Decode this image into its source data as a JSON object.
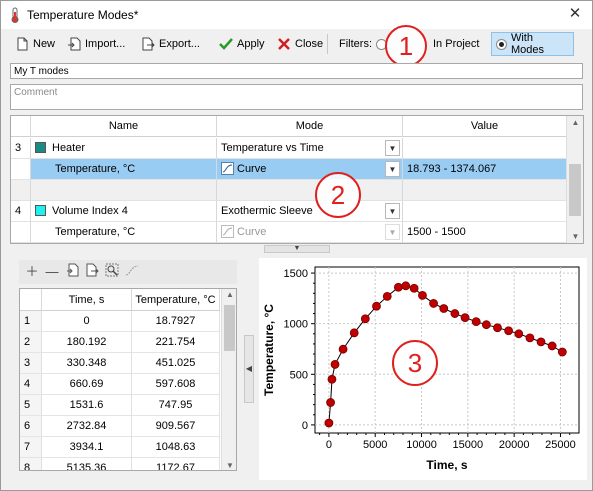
{
  "window": {
    "title": "Temperature Modes*",
    "close_symbol": "✕"
  },
  "toolbar": {
    "new": "New",
    "import": "Import...",
    "export": "Export...",
    "apply": "Apply",
    "close": "Close",
    "filters": "Filters:",
    "in_project": "In Project",
    "with_modes": "With Modes",
    "with_modes_selected": true
  },
  "name_field": {
    "value": "My T modes"
  },
  "comment_field": {
    "placeholder": "Comment"
  },
  "grid": {
    "columns": [
      "Name",
      "Mode",
      "Value"
    ],
    "rows": [
      {
        "index": "3",
        "name": "Heater",
        "color": "#1a8a84",
        "mode": "Temperature vs Time",
        "value": ""
      },
      {
        "index": "",
        "name": "Temperature, °C",
        "mode": "Curve",
        "value": "18.793 - 1374.067",
        "selected": true
      },
      {
        "index": "",
        "name": "",
        "mode": "",
        "value": ""
      },
      {
        "index": "4",
        "name": "Volume Index 4",
        "color": "#20f0f0",
        "mode": "Exothermic Sleeve",
        "value": ""
      },
      {
        "index": "",
        "name": "Temperature, °C",
        "mode": "Curve",
        "value": "1500 - 1500",
        "disabled": true
      }
    ]
  },
  "data_table": {
    "columns": [
      "Time, s",
      "Temperature, °C"
    ],
    "rows": [
      [
        "1",
        "0",
        "18.7927"
      ],
      [
        "2",
        "180.192",
        "221.754"
      ],
      [
        "3",
        "330.348",
        "451.025"
      ],
      [
        "4",
        "660.69",
        "597.608"
      ],
      [
        "5",
        "1531.6",
        "747.95"
      ],
      [
        "6",
        "2732.84",
        "909.567"
      ],
      [
        "7",
        "3934.1",
        "1048.63"
      ],
      [
        "8",
        "5135.36",
        "1172.67"
      ]
    ]
  },
  "annotations": [
    "1",
    "2",
    "3"
  ],
  "colors": {
    "accent": "#cce4f7",
    "selection": "#99ccf3",
    "annotation": "#e0201f",
    "marker": "#c00000"
  },
  "chart_data": {
    "type": "line",
    "xlabel": "Time, s",
    "ylabel": "Temperature, °C",
    "xlim": [
      -1500,
      27000
    ],
    "ylim": [
      -80,
      1560
    ],
    "xticks": [
      0,
      5000,
      10000,
      15000,
      20000,
      25000
    ],
    "yticks": [
      0,
      500,
      1000,
      1500
    ],
    "grid": true,
    "x": [
      0,
      180.192,
      330.348,
      660.69,
      1531.6,
      2732.84,
      3934.1,
      5135.36,
      6300,
      7500,
      8300,
      9200,
      10100,
      11300,
      12400,
      13600,
      14700,
      15900,
      17000,
      18200,
      19400,
      20500,
      21700,
      22900,
      24100,
      25200
    ],
    "y": [
      18.7927,
      221.754,
      451.025,
      597.608,
      747.95,
      909.567,
      1048.63,
      1172.67,
      1270,
      1360,
      1374.067,
      1350,
      1280,
      1200,
      1150,
      1100,
      1060,
      1020,
      990,
      960,
      930,
      900,
      860,
      820,
      780,
      720
    ]
  }
}
